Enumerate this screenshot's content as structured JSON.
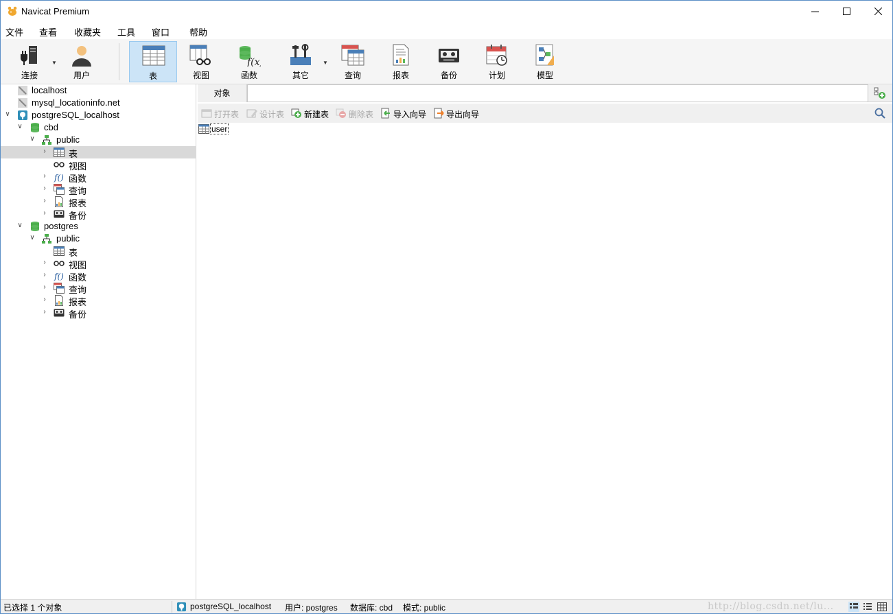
{
  "window": {
    "title": "Navicat Premium"
  },
  "menu": [
    "文件",
    "查看",
    "收藏夹",
    "工具",
    "窗口",
    "帮助"
  ],
  "toolbar": {
    "buttons": [
      {
        "label": "连接",
        "icon": "connection-icon"
      },
      {
        "label": "用户",
        "icon": "user-icon"
      },
      {
        "label": "表",
        "icon": "table-icon",
        "active": true
      },
      {
        "label": "视图",
        "icon": "view-icon"
      },
      {
        "label": "函数",
        "icon": "function-icon"
      },
      {
        "label": "其它",
        "icon": "other-icon"
      },
      {
        "label": "查询",
        "icon": "query-icon"
      },
      {
        "label": "报表",
        "icon": "report-icon"
      },
      {
        "label": "备份",
        "icon": "backup-icon"
      },
      {
        "label": "计划",
        "icon": "schedule-icon"
      },
      {
        "label": "模型",
        "icon": "model-icon"
      }
    ]
  },
  "tree": [
    {
      "label": "localhost",
      "icon": "mysql-connection-icon"
    },
    {
      "label": "mysql_locationinfo.net",
      "icon": "mysql-connection-icon"
    },
    {
      "label": "postgreSQL_localhost",
      "icon": "postgresql-connection-icon",
      "expanded": true
    },
    {
      "label": "cbd",
      "icon": "database-icon",
      "expanded": true
    },
    {
      "label": "public",
      "icon": "schema-icon",
      "expanded": true
    },
    {
      "label": "表",
      "icon": "table-icon",
      "selected": true
    },
    {
      "label": "视图",
      "icon": "view-icon"
    },
    {
      "label": "函数",
      "icon": "function-icon"
    },
    {
      "label": "查询",
      "icon": "query-icon"
    },
    {
      "label": "报表",
      "icon": "report-icon"
    },
    {
      "label": "备份",
      "icon": "backup-icon"
    },
    {
      "label": "postgres",
      "icon": "database-icon",
      "expanded": true
    },
    {
      "label": "public",
      "icon": "schema-icon",
      "expanded": true
    },
    {
      "label": "表",
      "icon": "table-icon"
    },
    {
      "label": "视图",
      "icon": "view-icon"
    },
    {
      "label": "函数",
      "icon": "function-icon"
    },
    {
      "label": "查询",
      "icon": "query-icon"
    },
    {
      "label": "报表",
      "icon": "report-icon"
    },
    {
      "label": "备份",
      "icon": "backup-icon"
    }
  ],
  "tabs": {
    "objects": "对象"
  },
  "object_toolbar": [
    {
      "label": "打开表",
      "enabled": false
    },
    {
      "label": "设计表",
      "enabled": false
    },
    {
      "label": "新建表",
      "enabled": true
    },
    {
      "label": "删除表",
      "enabled": false
    },
    {
      "label": "导入向导",
      "enabled": true
    },
    {
      "label": "导出向导",
      "enabled": true
    }
  ],
  "objects": [
    {
      "name": "user"
    }
  ],
  "status": {
    "selection": "已选择 1 个对象",
    "connection": "postgreSQL_localhost",
    "user": "用户: postgres",
    "database": "数据库: cbd",
    "schema": "模式: public",
    "watermark": "http://blog.csdn.net/lu..."
  }
}
